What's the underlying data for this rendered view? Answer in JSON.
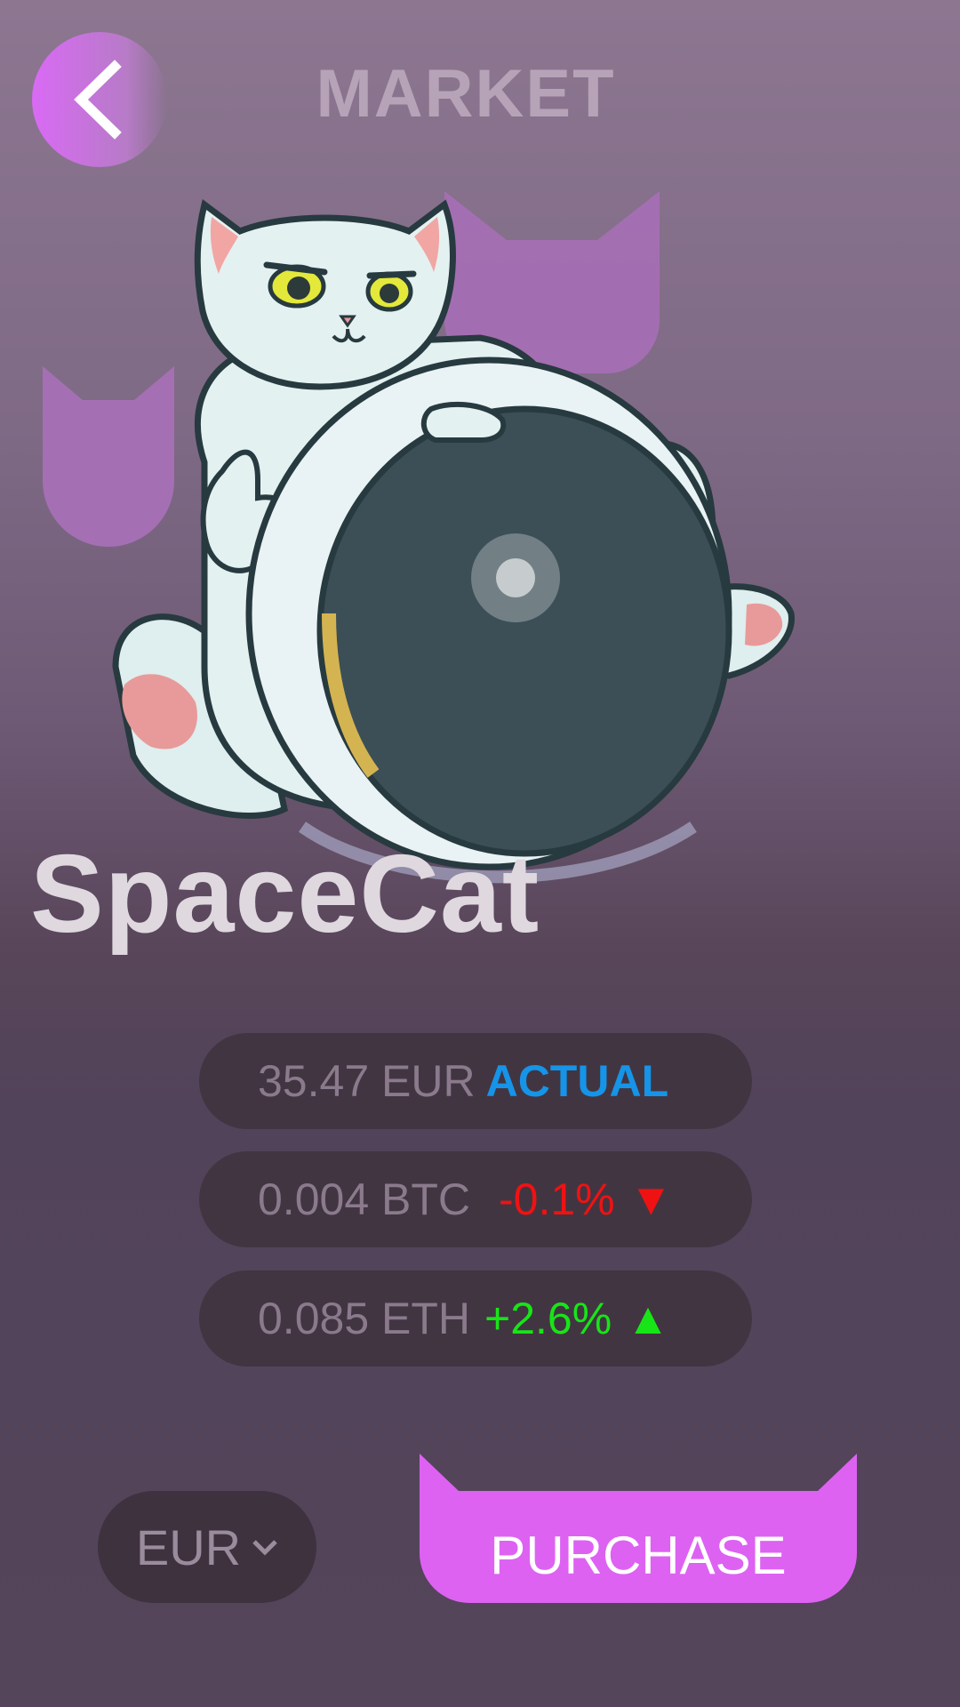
{
  "header": {
    "title": "MARKET",
    "back_icon": "chevron-left-icon"
  },
  "product": {
    "name": "SpaceCat",
    "image": "spacecat-mascot"
  },
  "prices": [
    {
      "amount": "35.47 EUR",
      "tag": "ACTUAL"
    },
    {
      "amount": "0.004 BTC",
      "change": "-0.1%",
      "direction": "▼"
    },
    {
      "amount": "0.085 ETH",
      "change": "+2.6%",
      "direction": "▲"
    }
  ],
  "controls": {
    "currency": "EUR",
    "purchase_label": "PURCHASE"
  },
  "colors": {
    "accent": "#dd62f2",
    "actual": "#1594e8",
    "negative": "#f01212",
    "positive": "#17e517"
  }
}
